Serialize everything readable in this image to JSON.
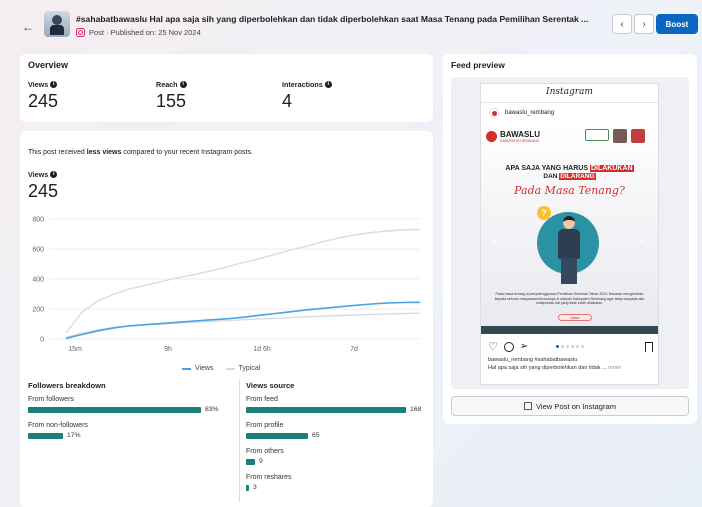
{
  "header": {
    "back_icon": "arrow-left-icon",
    "post_title": "#sahabatbawaslu Hal apa saja sih yang diperbolehkan dan tidak diperbolehkan saat Masa Tenang pada Pemilihan Serentak ...",
    "post_meta": "Post · Published on: 25 Nov 2024",
    "prev_label": "‹",
    "next_label": "›",
    "boost_label": "Boost"
  },
  "overview": {
    "title": "Overview",
    "metrics": [
      {
        "label": "Views",
        "value": "245"
      },
      {
        "label": "Reach",
        "value": "155"
      },
      {
        "label": "Interactions",
        "value": "4"
      }
    ]
  },
  "performance": {
    "note_prefix": "This post received ",
    "note_bold": "less views",
    "note_suffix": " compared to your recent Instagram posts.",
    "views_label": "Views",
    "views_value": "245"
  },
  "chart_data": {
    "type": "line",
    "x_ticks": [
      "15m",
      "9h",
      "1d 6h",
      "7d"
    ],
    "y_ticks": [
      "0",
      "200",
      "400",
      "600",
      "800"
    ],
    "ylim": [
      0,
      800
    ],
    "grid": true,
    "legend_position": "bottom",
    "series": [
      {
        "name": "Views",
        "color": "#4aa3df",
        "values": [
          5,
          30,
          55,
          75,
          88,
          96,
          104,
          112,
          120,
          128,
          135,
          145,
          158,
          170,
          182,
          195,
          205,
          215,
          225,
          233,
          240,
          243,
          245
        ]
      },
      {
        "name": "Typical",
        "color": "#d9dcdf",
        "values": [
          40,
          180,
          255,
          300,
          335,
          360,
          385,
          410,
          430,
          455,
          480,
          510,
          535,
          565,
          595,
          620,
          650,
          675,
          695,
          710,
          720,
          728,
          730
        ]
      },
      {
        "name": "",
        "color": "#d9dcdf",
        "values": [
          10,
          40,
          62,
          78,
          88,
          95,
          100,
          106,
          112,
          118,
          122,
          128,
          133,
          138,
          143,
          148,
          152,
          157,
          160,
          164,
          167,
          170,
          172
        ]
      }
    ]
  },
  "followers": {
    "title": "Followers breakdown",
    "rows": [
      {
        "label": "From followers",
        "value": "83%",
        "fraction": 0.83
      },
      {
        "label": "From non-followers",
        "value": "17%",
        "fraction": 0.17
      }
    ]
  },
  "views_source": {
    "title": "Views source",
    "rows": [
      {
        "label": "From feed",
        "value": "168",
        "count": 168
      },
      {
        "label": "From profile",
        "value": "65",
        "count": 65
      },
      {
        "label": "From others",
        "value": "9",
        "count": 9
      },
      {
        "label": "From reshares",
        "value": "3",
        "count": 3
      }
    ]
  },
  "feed_preview": {
    "title": "Feed preview",
    "ig_logo": "Instagram",
    "account": "bawaslu_rembang",
    "img_logo": "BAWASLU",
    "img_logo_sub": "KABUPATEN REMBANG",
    "headline_a": "APA SAJA YANG HARUS",
    "headline_a_red": "DILAKUKAN",
    "headline_b": "DAN",
    "headline_b_red": "DILARANG",
    "headline_c": "Pada Masa Tenang?",
    "body_text": "Pada masa tenang di penyelenggaraan Pemilihan Serentak Tahun 2024, Bawaslu menghimbau kepada seluruh masyarakat khususnya di wilayah Kabupaten Rembang agar tetap waspada dan melaporkan hal yang tidak boleh dilakukan.",
    "cta": "Geser",
    "caption_user": "bawaslu_rembang #sahabatbawaslu",
    "caption_text": "Hal apa saja sih yang diperbolehkan dan tidak ...",
    "caption_more": " more",
    "view_button": "View Post on Instagram",
    "view_icon": "external-link-icon"
  }
}
